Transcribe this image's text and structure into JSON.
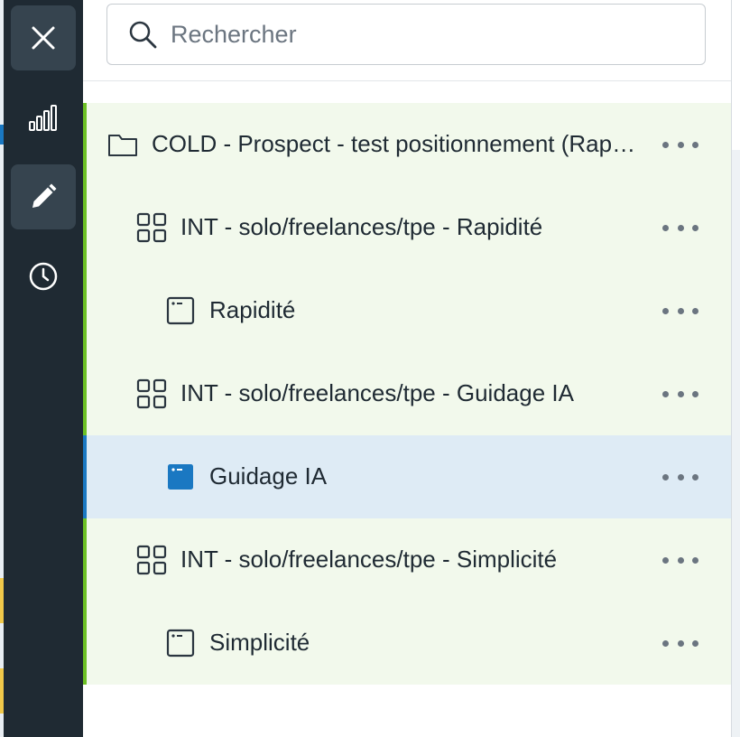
{
  "rail": {
    "items": [
      {
        "icon": "close-icon",
        "active": true
      },
      {
        "icon": "bar-chart-icon",
        "active": false
      },
      {
        "icon": "pencil-icon",
        "active": true
      },
      {
        "icon": "clock-icon",
        "active": false
      }
    ]
  },
  "search": {
    "placeholder": "Rechercher",
    "value": ""
  },
  "tree": {
    "items": [
      {
        "label": "COLD - Prospect - test positionnement (Rapidité/Guidage IA/Simplicité)",
        "icon": "folder-icon",
        "level": 0
      },
      {
        "label": "INT - solo/freelances/tpe - Rapidité",
        "icon": "grid-icon",
        "level": 1
      },
      {
        "label": "Rapidité",
        "icon": "page-icon",
        "level": 2
      },
      {
        "label": "INT - solo/freelances/tpe - Guidage IA",
        "icon": "grid-icon",
        "level": 1
      },
      {
        "label": "Guidage IA",
        "icon": "page-filled-icon",
        "level": 2,
        "selected": true
      },
      {
        "label": "INT - solo/freelances/tpe - Simplicité",
        "icon": "grid-icon",
        "level": 1
      },
      {
        "label": "Simplicité",
        "icon": "page-icon",
        "level": 2
      }
    ]
  },
  "colors": {
    "rail_bg": "#1f2a33",
    "row_bg": "#f2f9ec",
    "row_accent": "#6cc024",
    "selected_bg": "#deebf5",
    "selected_accent": "#1a78c2"
  }
}
